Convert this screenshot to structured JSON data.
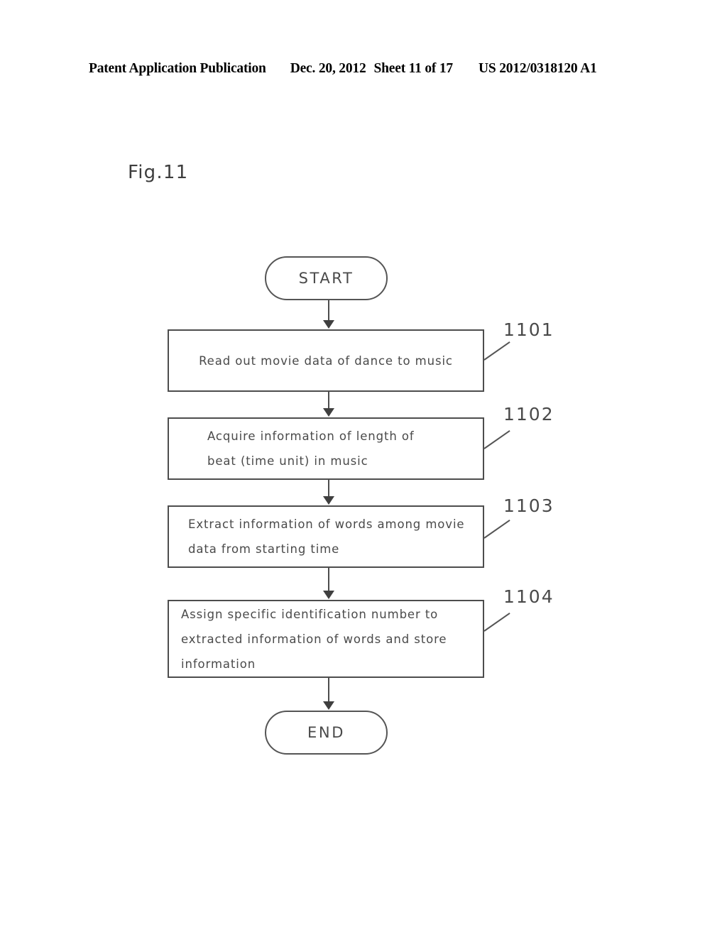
{
  "header": {
    "publication": "Patent Application Publication",
    "date": "Dec. 20, 2012",
    "sheet": "Sheet 11 of 17",
    "document_number": "US 2012/0318120 A1"
  },
  "figure": {
    "label": "Fig.11"
  },
  "flowchart": {
    "start": {
      "label": "START"
    },
    "end": {
      "label": "END"
    },
    "steps": [
      {
        "ref": "1101",
        "lines": [
          "Read out movie data of dance to music"
        ]
      },
      {
        "ref": "1102",
        "lines": [
          "Acquire  information  of  length  of",
          "beat (time unit) in  music"
        ]
      },
      {
        "ref": "1103",
        "lines": [
          "Extract  information  of  words  among  movie",
          "data from starting time"
        ]
      },
      {
        "ref": "1104",
        "lines": [
          "Assign  specific  identification  number  to",
          "extracted  information  of  words  and  store",
          "information"
        ]
      }
    ]
  },
  "colors": {
    "stroke": "#4d4d4d",
    "text": "#4a4a4a",
    "background": "#ffffff"
  }
}
